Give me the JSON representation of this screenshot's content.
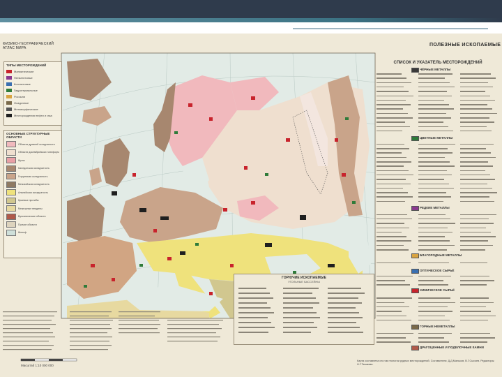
{
  "slide": {
    "header_color": "#2f3b4c",
    "accent_color": "#3b7283"
  },
  "map": {
    "atlas_title": "ФИЗИКО-ГЕОГРАФИЧЕСКИЙ АТЛАС МИРА",
    "title": "ПОЛЕЗНЫЕ ИСКОПАЕМЫЕ",
    "deposit_types_title": "ТИПЫ МЕСТОРОЖДЕНИЙ",
    "deposit_types": [
      "Магматические",
      "Пегматитовые",
      "Контактовые",
      "Гидротермальные",
      "Россыпи",
      "Осадочные",
      "Метаморфические",
      "Месторождения нефти и газа"
    ],
    "structures_title": "ОСНОВНЫЕ СТРУКТУРНЫЕ ОБЛАСТИ",
    "structures": [
      "Области древней складчатости",
      "Области докембрийских платформ",
      "Щиты",
      "Каледонская складчатость",
      "Герцинская складчатость",
      "Мезозойская складчатость",
      "Альпийская складчатость",
      "Краевые прогибы",
      "Межгорные впадины",
      "Вулканические области",
      "Прочие области",
      "Шельф"
    ],
    "index_title": "СПИСОК И УКАЗАТЕЛЬ МЕСТОРОЖДЕНИЙ",
    "index_sections": [
      "ЧЁРНЫЕ МЕТАЛЛЫ",
      "ЦВЕТНЫЕ МЕТАЛЛЫ",
      "РЕДКИЕ МЕТАЛЛЫ",
      "БЛАГОРОДНЫЕ МЕТАЛЛЫ",
      "ОПТИЧЕСКОЕ СЫРЬЁ",
      "ХИМИЧЕСКОЕ СЫРЬЁ",
      "ГОРНЫЕ НЕМЕТАЛЛЫ",
      "ДРАГОЦЕННЫЕ И ПОДЕЛОЧНЫЕ КАМНИ"
    ],
    "coal_title": "ГОРЮЧИЕ ИСКОПАЕМЫЕ",
    "coal_subtitle": "УГОЛЬНЫЕ БАССЕЙНЫ",
    "oil_label": "НЕФТЬ",
    "shale_label": "ГАЗ ГОРЮЧИЙ",
    "peat_label": "СЛАНЦЫ ГОРЮЧИЕ",
    "scale_text": "Масштаб 1:10 000 000",
    "credits": "Карта составлена ин-том геологии рудных месторождений. Составители: Д.Д.Мальков, В.Г.Сысоев. Редакторы: Н.Г.Тюшкова.",
    "colors": {
      "sea": "#e2ebe6",
      "platform": "#efdfcf",
      "shield": "#f1b9bd",
      "caledonian": "#a7876f",
      "hercynian": "#c9a48a",
      "alpine": "#efe27c",
      "foredeep": "#d1c78f",
      "oil": "#1f1f1f",
      "deposit_red": "#c8232c",
      "deposit_green": "#2f7b3a"
    }
  }
}
